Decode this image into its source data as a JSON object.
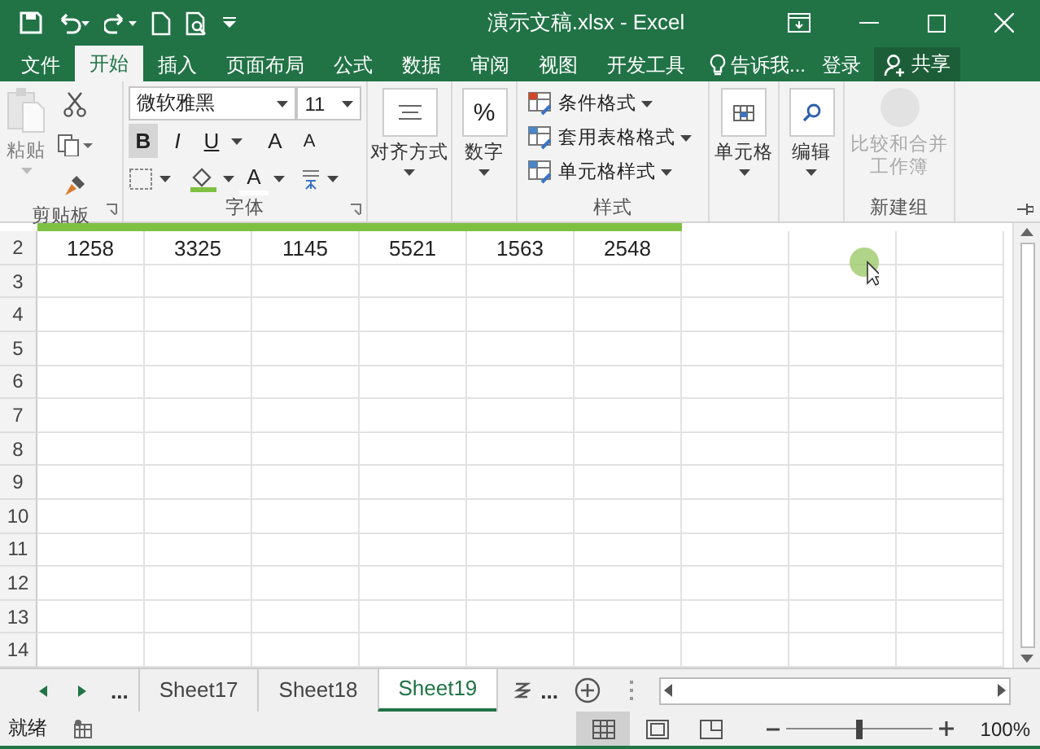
{
  "window": {
    "title": "演示文稿.xlsx - Excel"
  },
  "ribbon_tabs": [
    {
      "label": "文件",
      "selected": false
    },
    {
      "label": "开始",
      "selected": true
    },
    {
      "label": "插入",
      "selected": false
    },
    {
      "label": "页面布局",
      "selected": false
    },
    {
      "label": "公式",
      "selected": false
    },
    {
      "label": "数据",
      "selected": false
    },
    {
      "label": "审阅",
      "selected": false
    },
    {
      "label": "视图",
      "selected": false
    },
    {
      "label": "开发工具",
      "selected": false
    }
  ],
  "tell_me": "告诉我...",
  "sign_in": "登录",
  "share": "共享",
  "clipboard": {
    "paste": "粘贴",
    "label": "剪贴板"
  },
  "font": {
    "name": "微软雅黑",
    "size": "11",
    "label": "字体",
    "bold": "B",
    "bold_on": true,
    "italic": "I",
    "underline": "U",
    "grow": "A",
    "shrink": "A",
    "font_color": "A"
  },
  "alignment": "对齐方式",
  "number": {
    "symbol": "%",
    "label": "数字"
  },
  "styles": {
    "items": [
      "条件格式",
      "套用表格格式",
      "单元格样式"
    ],
    "label": "样式"
  },
  "cells": "单元格",
  "editing": "编辑",
  "new_group": {
    "button": "比较和合并工作簿",
    "disabled": true,
    "label": "新建组"
  },
  "grid": {
    "rows": [
      {
        "header": "2",
        "cells": [
          "1258",
          "3325",
          "1145",
          "5521",
          "1563",
          "2548"
        ]
      },
      {
        "header": "3"
      },
      {
        "header": "4"
      },
      {
        "header": "5"
      },
      {
        "header": "6"
      },
      {
        "header": "7"
      },
      {
        "header": "8"
      },
      {
        "header": "9"
      },
      {
        "header": "10"
      },
      {
        "header": "11"
      },
      {
        "header": "12"
      },
      {
        "header": "13"
      },
      {
        "header": "14"
      }
    ]
  },
  "sheet_tabs": {
    "overflow": "...",
    "tabs": [
      {
        "label": "Sheet17",
        "selected": false
      },
      {
        "label": "Sheet18",
        "selected": false
      },
      {
        "label": "Sheet19",
        "selected": true
      }
    ],
    "more": "..."
  },
  "status": {
    "text": "就绪",
    "views": [
      {
        "kind": "normal",
        "selected": true
      },
      {
        "kind": "page_layout",
        "selected": false
      },
      {
        "kind": "page_break",
        "selected": false
      }
    ],
    "level": 0.5,
    "zoom": "100%"
  }
}
